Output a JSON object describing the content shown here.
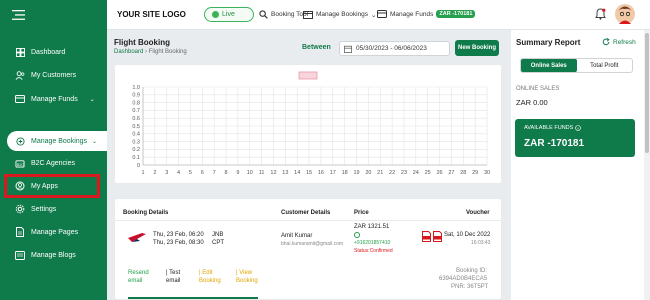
{
  "sidebar": {
    "items": [
      {
        "label": "Dashboard",
        "icon": "dashboard-icon"
      },
      {
        "label": "My Customers",
        "icon": "customers-icon"
      },
      {
        "label": "Manage Funds",
        "icon": "funds-icon",
        "caret": "⌄"
      },
      {
        "label": "Manage Bookings",
        "icon": "bookings-icon",
        "caret": "⌄"
      },
      {
        "label": "B2C Agencies",
        "icon": "agencies-icon"
      },
      {
        "label": "My Apps",
        "icon": "apps-icon"
      },
      {
        "label": "Settings",
        "icon": "settings-icon"
      },
      {
        "label": "Manage Pages",
        "icon": "pages-icon"
      },
      {
        "label": "Manage Blogs",
        "icon": "blogs-icon"
      }
    ]
  },
  "topbar": {
    "logo": "YOUR SITE LOGO",
    "live": "Live",
    "booking_tool": "Booking Tool",
    "manage_bookings": "Manage Bookings",
    "manage_bookings_caret": "⌄",
    "manage_funds": "Manage Funds",
    "funds_badge": "ZAR -170181"
  },
  "page": {
    "title": "Flight Booking",
    "breadcrumb_home": "Dashboard",
    "breadcrumb_sep": "›",
    "breadcrumb_current": "Flight Booking",
    "between_label": "Between",
    "date_range": "05/30/2023 - 06/06/2023",
    "new_booking": "New Booking"
  },
  "chart_data": {
    "type": "line",
    "x": [
      1,
      2,
      3,
      4,
      5,
      6,
      7,
      8,
      9,
      10,
      11,
      12,
      13,
      14,
      15,
      16,
      17,
      18,
      19,
      20,
      21,
      22,
      23,
      24,
      25,
      26,
      27,
      28,
      29,
      30
    ],
    "ylim": [
      0,
      1.0
    ],
    "yticks": [
      "1.0",
      "0.9",
      "0.8",
      "0.7",
      "0.6",
      "0.5",
      "0.4",
      "0.3",
      "0.2",
      "0.1",
      "0"
    ],
    "series": [
      {
        "values": []
      }
    ],
    "grid": true,
    "legend": "top"
  },
  "table": {
    "headers": {
      "booking": "Booking Details",
      "customer": "Customer Details",
      "price": "Price",
      "voucher": "Voucher"
    },
    "row": {
      "depart": "Thu, 23 Feb, 06:20",
      "arrive": "Thu, 23 Feb, 08:30",
      "from": "JNB",
      "to": "CPT",
      "customer_name": "Amit Kumar",
      "customer_email": "bhai.kumaramit@gmail.com",
      "price": "ZAR 1321.51",
      "phone": "+916201857410",
      "status": "Status:Confirmed",
      "voucher_date": "Sat, 10 Dec 2022",
      "voucher_time": "16:03:43",
      "resend": "Resend",
      "resend2": "email",
      "test": "| Test",
      "test2": "email",
      "edit": "| Edit",
      "edit2": "Booking",
      "view": "| View",
      "view2": "Booking",
      "booking_id_label": "Booking ID:",
      "booking_id": "6394AD0B4ECA5",
      "pnr": "PNR: 36T5PT"
    }
  },
  "summary": {
    "title": "Summary Report",
    "refresh": "Refresh",
    "tab_online": "Online Sales",
    "tab_profit": "Total Profit",
    "online_label": "ONLINE SALES",
    "online_value": "ZAR 0.00",
    "funds_label": "AVAILABLE FUNDS",
    "funds_value": "ZAR -170181"
  },
  "colors": {
    "brand": "#0f7a4a",
    "highlight": "#d9191d",
    "live": "#3cb35a"
  }
}
